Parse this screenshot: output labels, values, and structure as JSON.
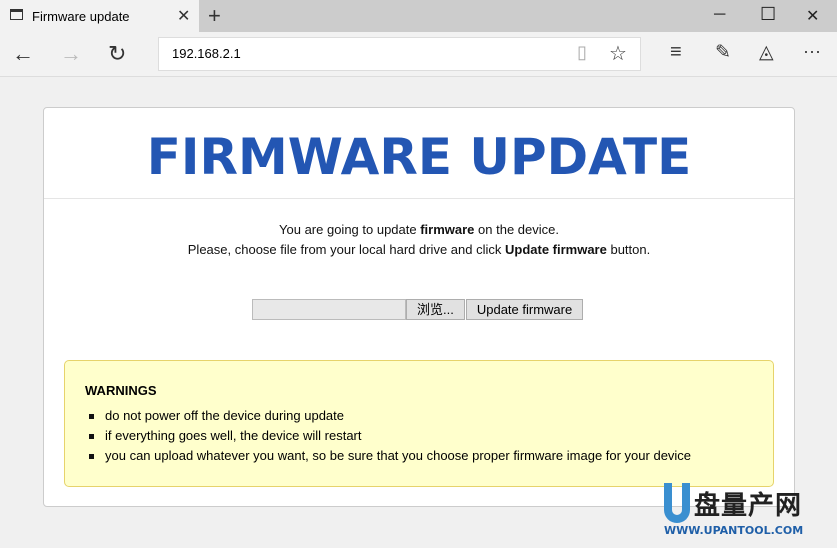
{
  "tab": {
    "title": "Firmware update"
  },
  "address": {
    "url": "192.168.2.1"
  },
  "page": {
    "title": "FIRMWARE UPDATE",
    "line1_pre": "You are going to update ",
    "line1_bold": "firmware",
    "line1_post": " on the device.",
    "line2_pre": "Please, choose file from your local hard drive and click ",
    "line2_bold": "Update firmware",
    "line2_post": " button.",
    "browse_label": "浏览...",
    "update_label": "Update firmware",
    "warnings_title": "WARNINGS",
    "warnings": [
      "do not power off the device during update",
      "if everything goes well, the device will restart",
      "you can upload whatever you want, so be sure that you choose proper firmware image for your device"
    ]
  },
  "watermark": {
    "brand": "盘量产网",
    "url": "WWW.UPANTOOL.COM"
  },
  "colors": {
    "title": "#2356b3",
    "warning_bg": "#ffffcc"
  }
}
